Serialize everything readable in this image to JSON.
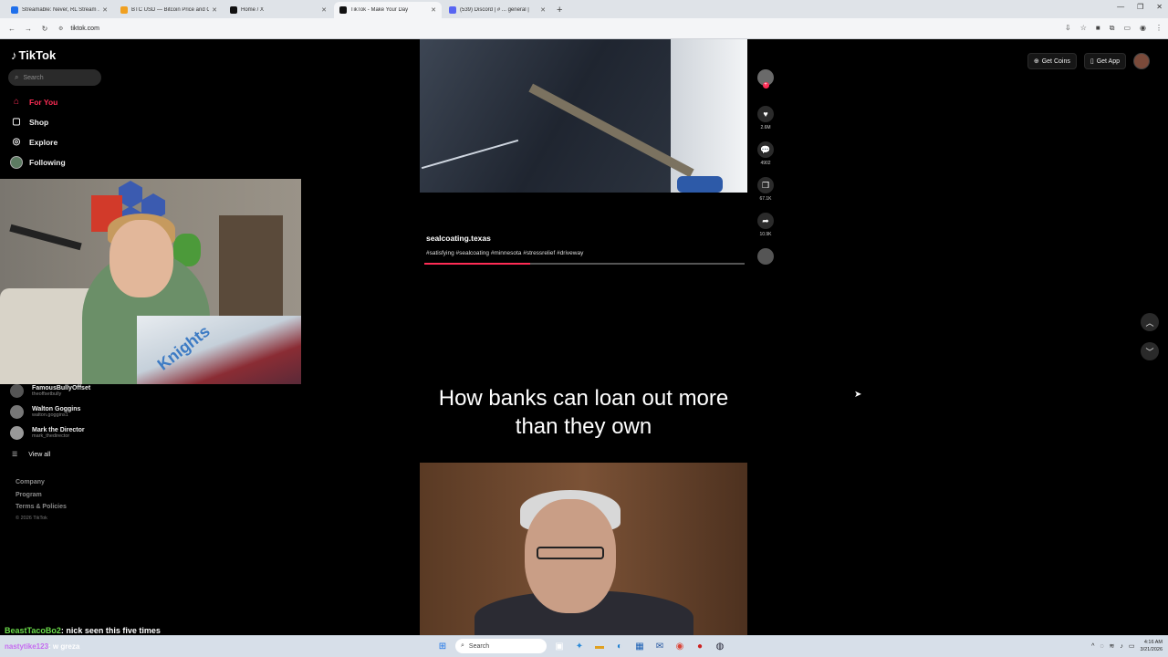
{
  "browser": {
    "tabs": [
      {
        "title": "Streamable: Never, RL Stream ...",
        "color": "#1f6feb",
        "active": false
      },
      {
        "title": "BTC USD — Bitcoin Price and C...",
        "color": "#f0a020",
        "active": false
      },
      {
        "title": "Home / X",
        "color": "#111111",
        "active": false
      },
      {
        "title": "TikTok - Make Your Day",
        "color": "#111111",
        "active": true
      },
      {
        "title": "(539) Discord | # ... general |",
        "color": "#5865f2",
        "active": false
      }
    ],
    "url": "tiktok.com"
  },
  "tiktok": {
    "logo": "TikTok",
    "search_placeholder": "Search",
    "nav": {
      "for_you": "For You",
      "shop": "Shop",
      "explore": "Explore",
      "following": "Following"
    },
    "following_list": [
      {
        "name": "FamousBullyOffset",
        "handle": "theoffsetbully"
      },
      {
        "name": "Walton Goggins",
        "handle": "walton.goggins1"
      },
      {
        "name": "Mark the Director",
        "handle": "mark_thedirector"
      }
    ],
    "view_all": "View all",
    "footer": {
      "company": "Company",
      "program": "Program",
      "terms": "Terms & Policies",
      "copyright": "© 2026 TikTok"
    },
    "top_right": {
      "get_coins": "Get Coins",
      "get_app": "Get App"
    },
    "video1": {
      "username": "sealcoating.texas",
      "hashtags": "#satisfying #sealcoating #minnesota #stressrelief #driveway",
      "progress": 0.33,
      "likes": "2.6M",
      "comments": "4902",
      "saves": "67.1K",
      "shares": "10.9K"
    },
    "video2": {
      "headline": "How banks can loan out more than they own"
    }
  },
  "stream_chat": [
    {
      "user": "BeastTacoBo2",
      "message": ": nick seen this five times"
    },
    {
      "user": "nastytike123",
      "message": ": w greza"
    }
  ],
  "taskbar": {
    "search_placeholder": "Search",
    "time": "4:16 AM",
    "date": "3/21/2026"
  },
  "colors": {
    "accent": "#fe2c55",
    "background": "#000000"
  }
}
